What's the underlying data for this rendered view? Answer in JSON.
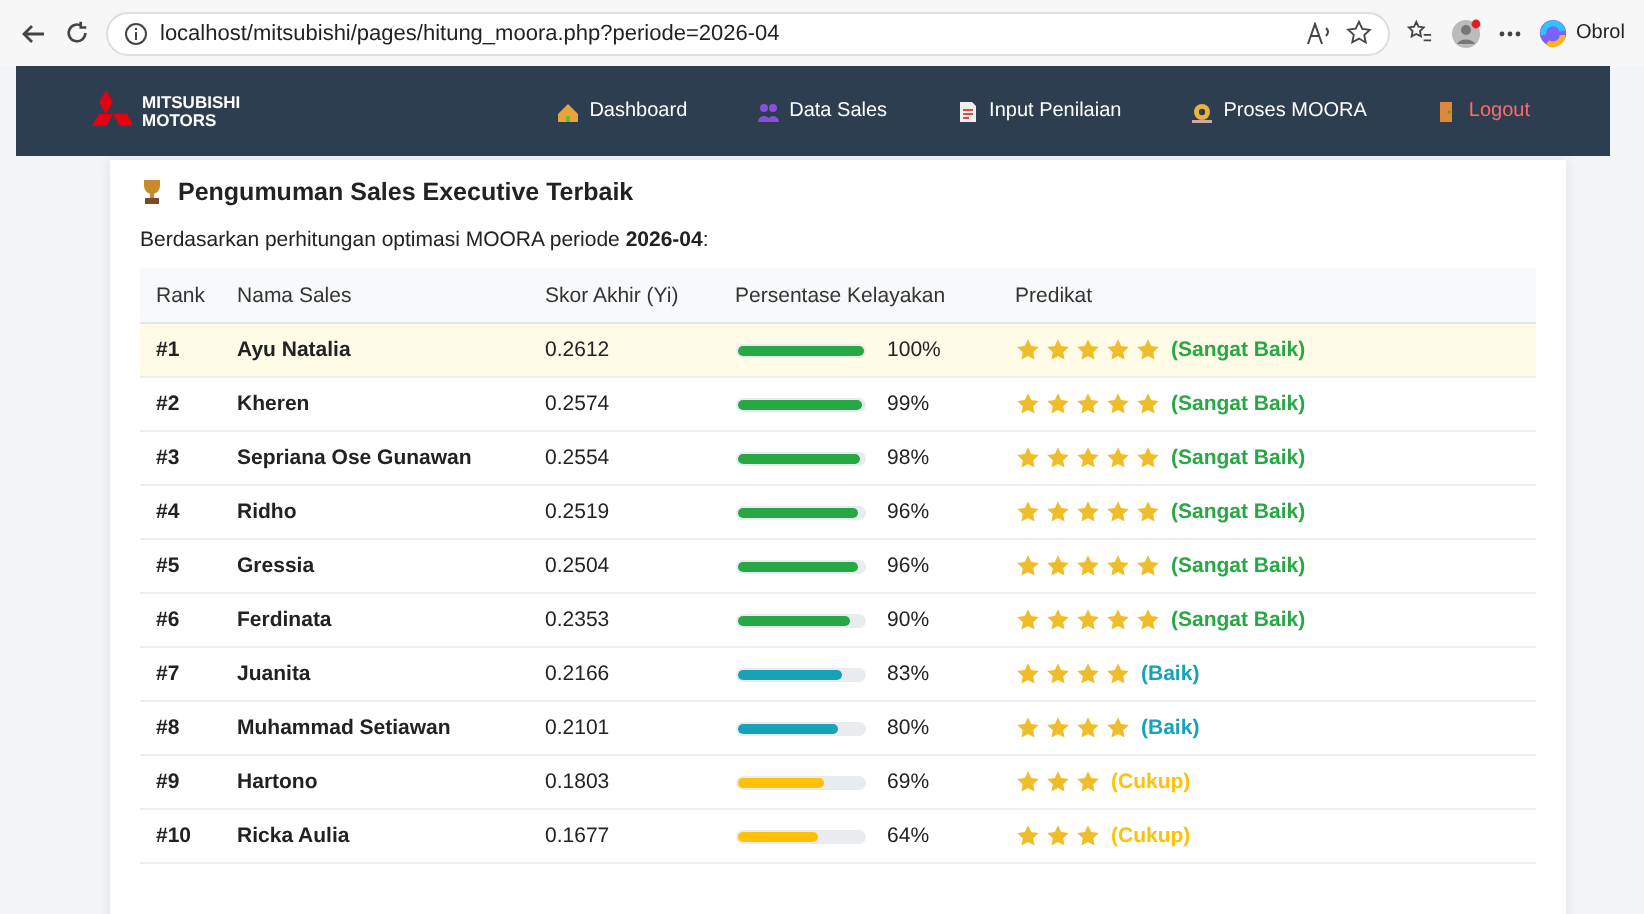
{
  "browser": {
    "url": "localhost/mitsubishi/pages/hitung_moora.php?periode=2026-04",
    "copilot_label": "Obrol"
  },
  "navbar": {
    "brand": [
      "MITSUBISHI",
      "MOTORS"
    ],
    "items": [
      {
        "label": "Dashboard",
        "kind": "house"
      },
      {
        "label": "Data Sales",
        "kind": "people"
      },
      {
        "label": "Input Penilaian",
        "kind": "document"
      },
      {
        "label": "Proses MOORA",
        "kind": "gear"
      },
      {
        "label": "Logout",
        "kind": "door"
      }
    ]
  },
  "card": {
    "title": "Pengumuman Sales Executive Terbaik",
    "intro": "Berdasarkan perhitungan optimasi MOORA periode **2026-04**:",
    "columns": [
      "Rank",
      "Nama Sales",
      "Skor Akhir (Yi)",
      "Persentase Kelayakan",
      "Predikat"
    ],
    "rows": [
      {
        "rank": "#1",
        "name": "Ayu Natalia",
        "score": "0.2612",
        "level": 1.0,
        "percent": "100%",
        "stars": 5,
        "predikat": "(Sangat Baik)",
        "color": "#28a745",
        "highlighted": true
      },
      {
        "rank": "#2",
        "name": "Kheren",
        "score": "0.2574",
        "level": 0.99,
        "percent": "99%",
        "stars": 5,
        "predikat": "(Sangat Baik)",
        "color": "#28a745",
        "highlighted": false
      },
      {
        "rank": "#3",
        "name": "Sepriana Ose Gunawan",
        "score": "0.2554",
        "level": 0.98,
        "percent": "98%",
        "stars": 5,
        "predikat": "(Sangat Baik)",
        "color": "#28a745",
        "highlighted": false
      },
      {
        "rank": "#4",
        "name": "Ridho",
        "score": "0.2519",
        "level": 0.96,
        "percent": "96%",
        "stars": 5,
        "predikat": "(Sangat Baik)",
        "color": "#28a745",
        "highlighted": false
      },
      {
        "rank": "#5",
        "name": "Gressia",
        "score": "0.2504",
        "level": 0.96,
        "percent": "96%",
        "stars": 5,
        "predikat": "(Sangat Baik)",
        "color": "#28a745",
        "highlighted": false
      },
      {
        "rank": "#6",
        "name": "Ferdinata",
        "score": "0.2353",
        "level": 0.9,
        "percent": "90%",
        "stars": 5,
        "predikat": "(Sangat Baik)",
        "color": "#28a745",
        "highlighted": false
      },
      {
        "rank": "#7",
        "name": "Juanita",
        "score": "0.2166",
        "level": 0.83,
        "percent": "83%",
        "stars": 4,
        "predikat": "(Baik)",
        "color": "#17a2b8",
        "highlighted": false
      },
      {
        "rank": "#8",
        "name": "Muhammad Setiawan",
        "score": "0.2101",
        "level": 0.8,
        "percent": "80%",
        "stars": 4,
        "predikat": "(Baik)",
        "color": "#17a2b8",
        "highlighted": false
      },
      {
        "rank": "#9",
        "name": "Hartono",
        "score": "0.1803",
        "level": 0.69,
        "percent": "69%",
        "stars": 3,
        "predikat": "(Cukup)",
        "color": "#ffc107",
        "highlighted": false
      },
      {
        "rank": "#10",
        "name": "Ricka Aulia",
        "score": "0.1677",
        "level": 0.64,
        "percent": "64%",
        "stars": 3,
        "predikat": "(Cukup)",
        "color": "#ffc107",
        "highlighted": false
      }
    ]
  }
}
